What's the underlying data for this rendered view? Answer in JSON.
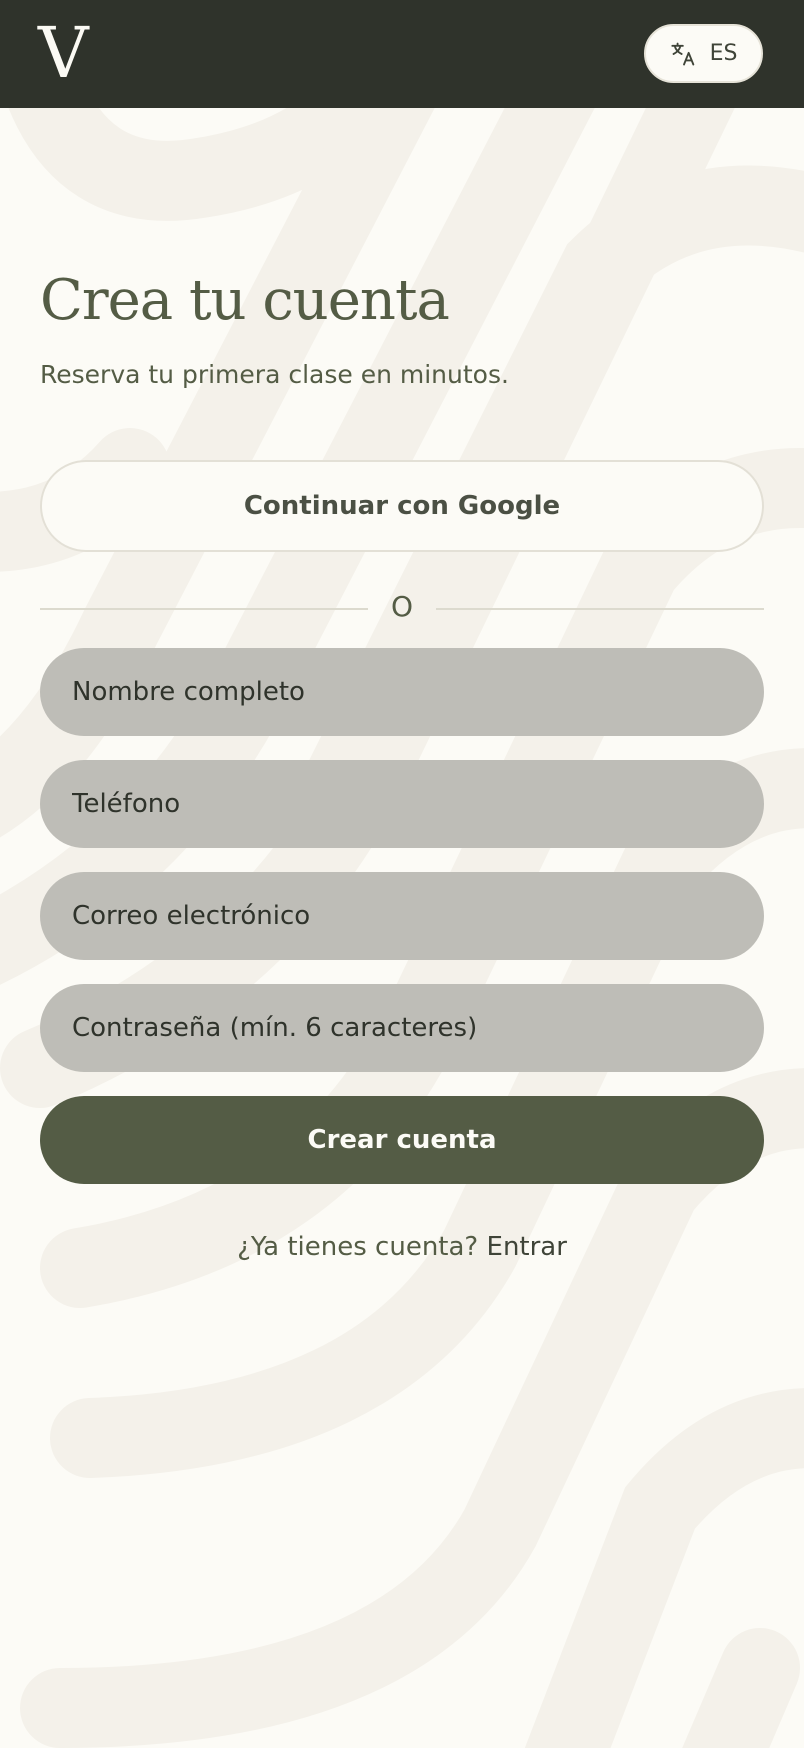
{
  "header": {
    "logo_text": "V",
    "language": {
      "icon": "translate-icon",
      "label": "ES"
    }
  },
  "main": {
    "title": "Crea tu cuenta",
    "subtitle": "Reserva tu primera clase en minutos.",
    "google_button_label": "Continuar con Google",
    "divider_text": "O",
    "fields": {
      "full_name_placeholder": "Nombre completo",
      "phone_placeholder": "Teléfono",
      "email_placeholder": "Correo electrónico",
      "password_placeholder": "Contraseña (mín. 6 caracteres)"
    },
    "submit_label": "Crear cuenta",
    "login_prompt": "¿Ya tienes cuenta?",
    "login_link": "Entrar"
  },
  "colors": {
    "header_bg": "#2f332b",
    "page_bg": "#fcfbf6",
    "pattern": "#f4f1ea",
    "accent": "#545c45",
    "field_bg": "#bebdb7"
  }
}
